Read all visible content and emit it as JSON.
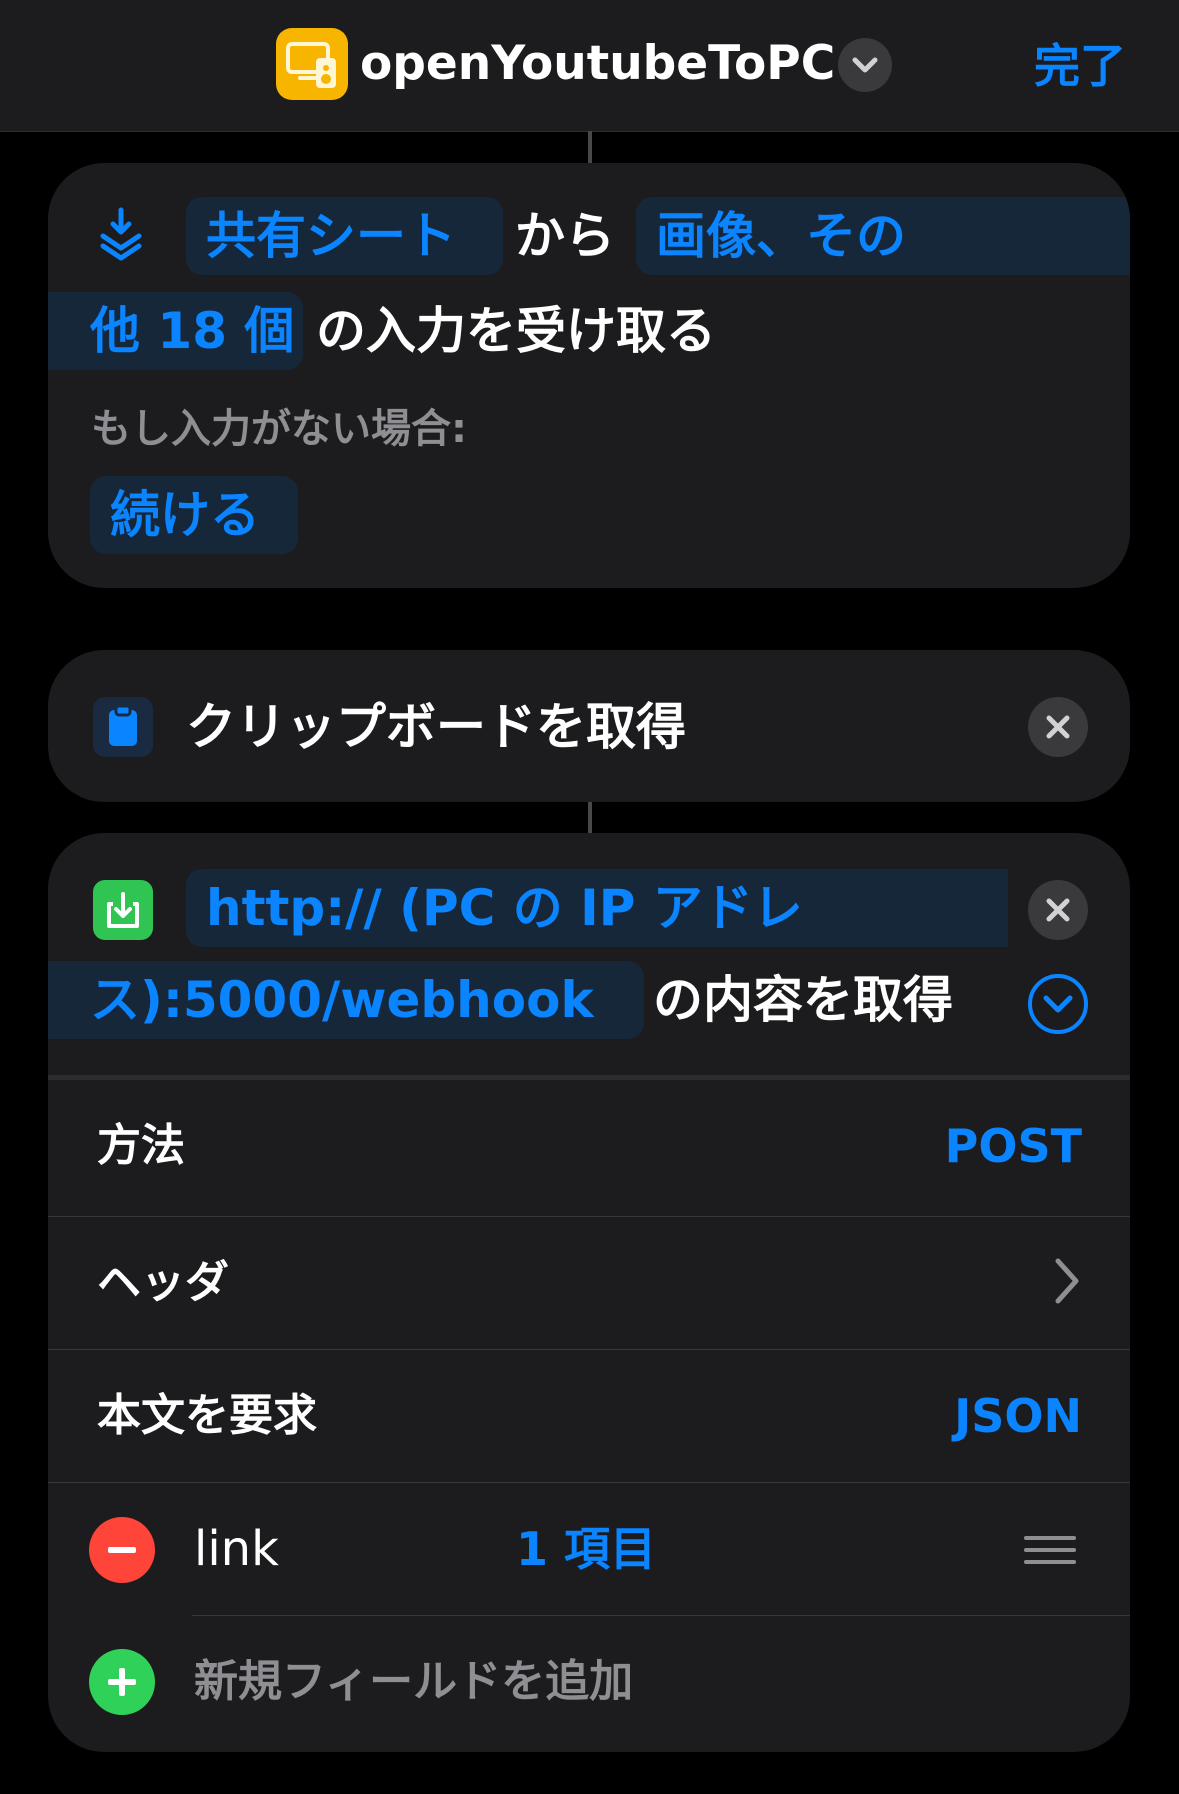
{
  "header": {
    "title": "openYoutubeToPC",
    "done_label": "完了"
  },
  "receive_action": {
    "source_token": "共有シート",
    "from_text": "から",
    "types_token_line1": "画像、その",
    "types_token_line2": "他 18 個",
    "receive_text": "の入力を受け取る",
    "if_no_input_label": "もし入力がない場合:",
    "continue_token": "続ける"
  },
  "clipboard_action": {
    "label": "クリップボードを取得"
  },
  "url_action": {
    "url_token_line1": "http:// (PC の IP アドレ",
    "url_token_line2": "ス):5000/webhook",
    "suffix_text": "の内容を取得",
    "rows": {
      "method_label": "方法",
      "method_value": "POST",
      "headers_label": "ヘッダ",
      "body_label": "本文を要求",
      "body_value": "JSON"
    },
    "field": {
      "key": "link",
      "value": "1 項目"
    },
    "add_field_label": "新規フィールドを追加"
  },
  "colors": {
    "accent": "#0a84ff",
    "app_icon": "#f7b500",
    "delete": "#ff453a",
    "add": "#30d158",
    "card": "#1c1c1e"
  }
}
